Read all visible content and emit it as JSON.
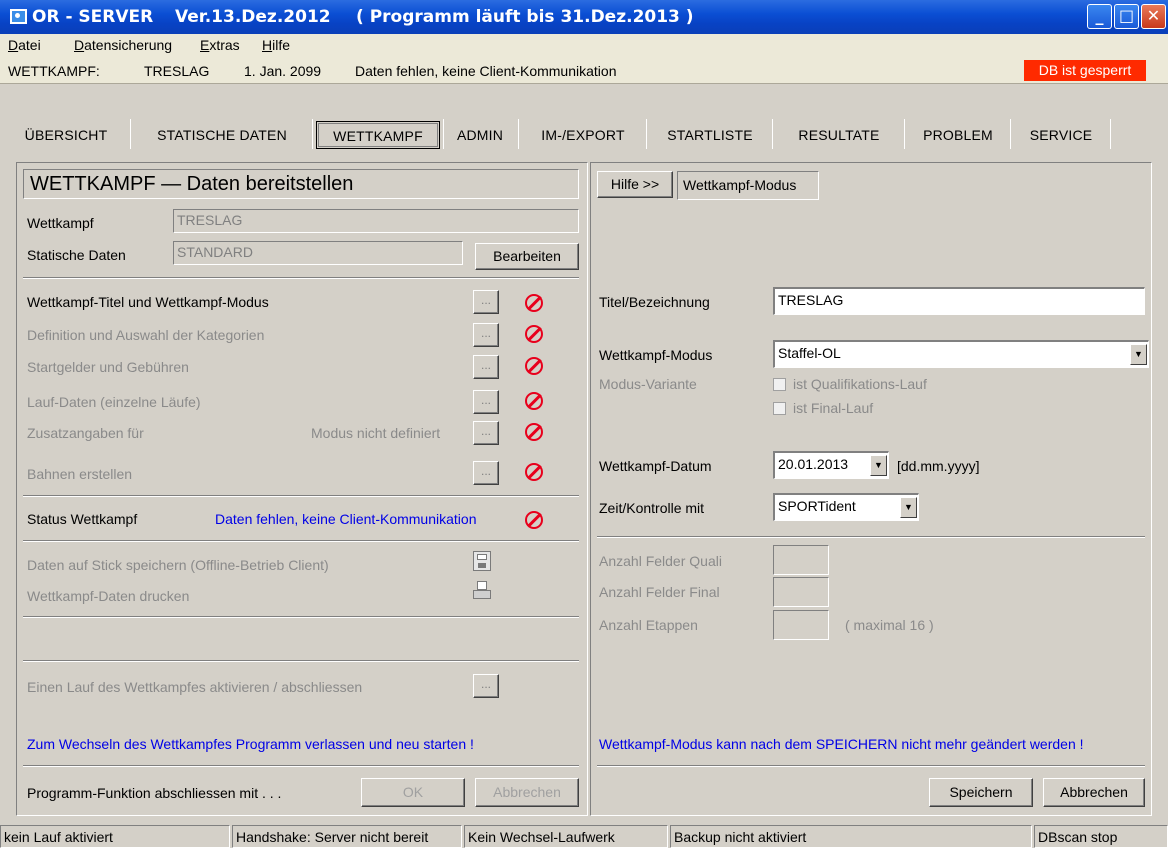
{
  "window": {
    "app_name": "OR - SERVER",
    "version": "Ver.13.Dez.2012",
    "license": "( Programm läuft bis 31.Dez.2013 )",
    "min": "_",
    "max": "□",
    "close": "✕"
  },
  "menu": {
    "datei": "Datei",
    "datensicherung": "Datensicherung",
    "extras": "Extras",
    "hilfe": "Hilfe"
  },
  "info": {
    "label": "WETTKAMPF:",
    "name": "TRESLAG",
    "date": "1. Jan. 2099",
    "status": "Daten fehlen, keine Client-Kommunikation",
    "db_lock": "DB ist gesperrt",
    "db_lock_color": "#ff2a00"
  },
  "tabs": [
    {
      "label": "ÜBERSICHT"
    },
    {
      "label": "STATISCHE DATEN"
    },
    {
      "label": "WETTKAMPF"
    },
    {
      "label": "ADMIN"
    },
    {
      "label": "IM-/EXPORT"
    },
    {
      "label": "STARTLISTE"
    },
    {
      "label": "RESULTATE"
    },
    {
      "label": "PROBLEM"
    },
    {
      "label": "SERVICE"
    }
  ],
  "left": {
    "heading": "WETTKAMPF — Daten bereitstellen",
    "wettkampf_label": "Wettkampf",
    "wettkampf_value": "TRESLAG",
    "statische_label": "Statische Daten",
    "statische_value": "STANDARD",
    "bearbeiten": "Bearbeiten",
    "items": [
      {
        "label": "Wettkampf-Titel und Wettkampf-Modus"
      },
      {
        "label": "Definition und Auswahl der Kategorien"
      },
      {
        "label": "Startgelder und Gebühren"
      },
      {
        "label": "Lauf-Daten (einzelne Läufe)"
      },
      {
        "label": "Zusatzangaben für"
      },
      {
        "label": "Bahnen erstellen"
      }
    ],
    "modus_nicht_definiert": "Modus nicht definiert",
    "ellipsis": "...",
    "status_label": "Status Wettkampf",
    "status_value": "Daten fehlen, keine Client-Kommunikation",
    "stick": "Daten auf Stick speichern (Offline-Betrieb Client)",
    "drucken": "Wettkampf-Daten drucken",
    "aktivieren": "Einen Lauf des Wettkampfes aktivieren / abschliessen",
    "wechsel_hint": "Zum Wechseln des Wettkampfes Programm verlassen und neu starten !",
    "abschluss": "Programm-Funktion abschliessen mit . . .",
    "ok": "OK",
    "abbrechen": "Abbrechen"
  },
  "right": {
    "hilfe_btn": "Hilfe >>",
    "mode_title": "Wettkampf-Modus",
    "titel_label": "Titel/Bezeichnung",
    "titel_value": "TRESLAG",
    "modus_label": "Wettkampf-Modus",
    "modus_value": "Staffel-OL",
    "variante_label": "Modus-Variante",
    "quali_check": "ist Qualifikations-Lauf",
    "final_check": "ist Final-Lauf",
    "datum_label": "Wettkampf-Datum",
    "datum_value": "20.01.2013",
    "datum_format": "[dd.mm.yyyy]",
    "zeit_label": "Zeit/Kontrolle mit",
    "zeit_value": "SPORTident",
    "felder_quali": "Anzahl Felder Quali",
    "felder_final": "Anzahl Felder Final",
    "etappen": "Anzahl Etappen",
    "maximal": "( maximal 16 )",
    "hint": "Wettkampf-Modus kann nach dem SPEICHERN nicht mehr geändert werden !",
    "speichern": "Speichern",
    "abbrechen": "Abbrechen"
  },
  "status": {
    "lauf": "kein Lauf aktiviert",
    "handshake": "Handshake: Server nicht bereit",
    "laufwerk": "Kein Wechsel-Laufwerk",
    "backup": "Backup nicht aktiviert",
    "dbscan": "DBscan stop"
  }
}
